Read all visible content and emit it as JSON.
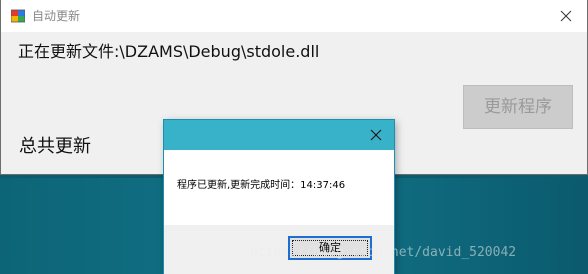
{
  "main_window": {
    "title": "自动更新",
    "file_label": "正在更新文件:\\DZAMS\\Debug\\stdole.dll",
    "update_button_label": "更新程序",
    "total_label": "总共更新",
    "icons": [
      "app-icon",
      "close-icon"
    ]
  },
  "dialog": {
    "message": "程序已更新,更新完成时间：14:37:46",
    "ok_label": "确定",
    "icons": [
      "close-icon"
    ]
  },
  "watermark": "https://blog.csdn.net/david_520042",
  "colors": {
    "dialog_titlebar": "#38b2c8",
    "window_background": "#f0f0f0",
    "desktop": "#0e5f72",
    "focus_border": "#1a6fd1"
  }
}
